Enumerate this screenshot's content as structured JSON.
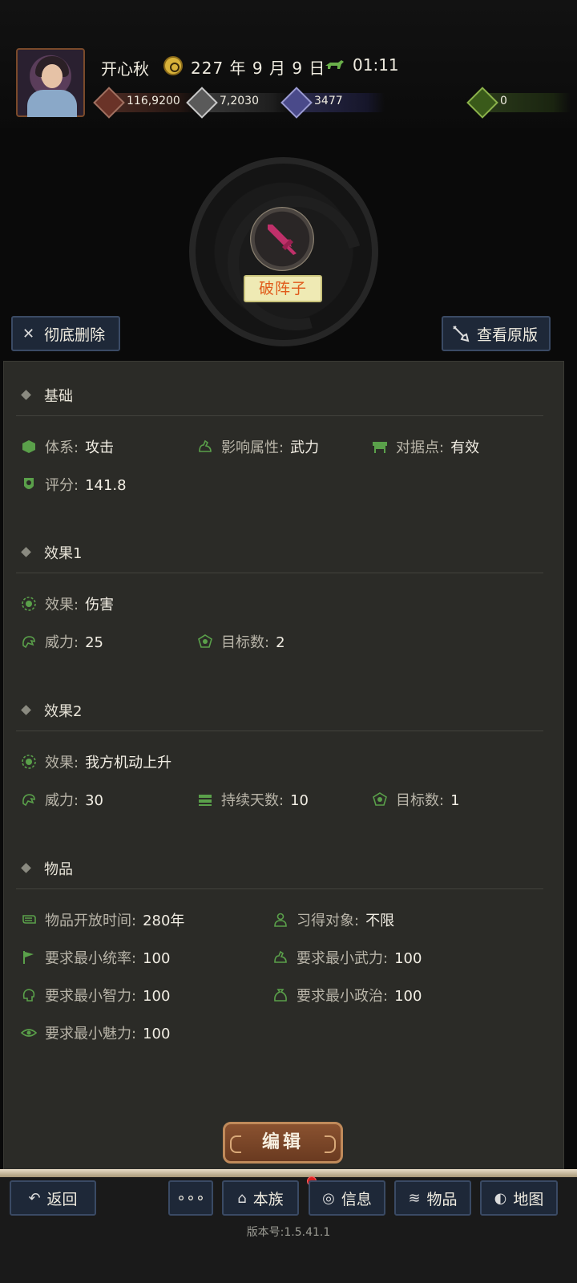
{
  "header": {
    "player_name": "开心秋",
    "date": "227 年 9 月 9 日",
    "time": "01:11",
    "resources": [
      {
        "name": "gold",
        "value": "116,9200"
      },
      {
        "name": "grain",
        "value": "7,2030"
      },
      {
        "name": "troops",
        "value": "3477"
      },
      {
        "name": "item",
        "value": "0"
      }
    ]
  },
  "skill": {
    "name": "破阵子",
    "icon": "sword-icon",
    "icon_color": "#c0306a"
  },
  "actions": {
    "delete_label": "彻底删除",
    "view_label": "查看原版"
  },
  "sections": {
    "basic": {
      "title": "基础",
      "system_k": "体系:",
      "system_v": "攻击",
      "affect_k": "影响属性:",
      "affect_v": "武力",
      "stronghold_k": "对据点:",
      "stronghold_v": "有效",
      "score_k": "评分:",
      "score_v": "141.8"
    },
    "effect1": {
      "title": "效果1",
      "effect_k": "效果:",
      "effect_v": "伤害",
      "power_k": "威力:",
      "power_v": "25",
      "targets_k": "目标数:",
      "targets_v": "2"
    },
    "effect2": {
      "title": "效果2",
      "effect_k": "效果:",
      "effect_v": "我方机动上升",
      "power_k": "威力:",
      "power_v": "30",
      "duration_k": "持续天数:",
      "duration_v": "10",
      "targets_k": "目标数:",
      "targets_v": "1"
    },
    "item": {
      "title": "物品",
      "open_time_k": "物品开放时间:",
      "open_time_v": "280年",
      "learner_k": "习得对象:",
      "learner_v": "不限",
      "min_lead_k": "要求最小统率:",
      "min_lead_v": "100",
      "min_war_k": "要求最小武力:",
      "min_war_v": "100",
      "min_int_k": "要求最小智力:",
      "min_int_v": "100",
      "min_pol_k": "要求最小政治:",
      "min_pol_v": "100",
      "min_cha_k": "要求最小魅力:",
      "min_cha_v": "100"
    }
  },
  "edit_label": "编辑",
  "bottom_nav": {
    "back": "返回",
    "more": "∘∘∘",
    "clan": "本族",
    "info": "信息",
    "items": "物品",
    "map": "地图"
  },
  "version": "版本号:1.5.41.1"
}
